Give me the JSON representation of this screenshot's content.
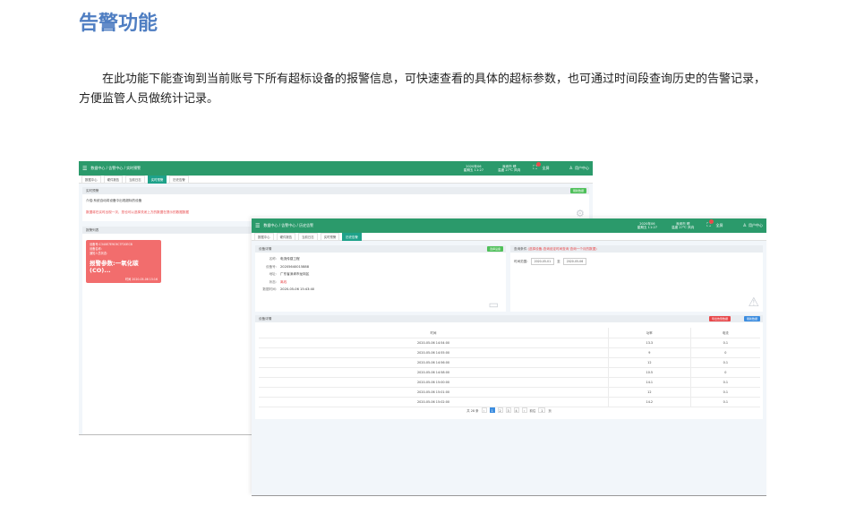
{
  "doc": {
    "title": "告警功能",
    "intro": "在此功能下能查询到当前账号下所有超标设备的报警信息，可快速查看的具体的超标参数，也可通过时间段查询历史的告警记录，方便监管人员做统计记录。"
  },
  "win1": {
    "breadcrumb": "数据中心 / 告警中心 / 实时预警",
    "stats": [
      {
        "line1": "2020年06",
        "line2": "星期五 11:27"
      },
      {
        "line1": "深圳市 晴",
        "line2": "温度 27℃ 风向"
      }
    ],
    "fullscreen": "全屏",
    "user": "用户中心",
    "tabs": [
      "数据中心",
      "硬件报告",
      "当前日志",
      "实时预警",
      "历史告警"
    ],
    "active_tab": "实时预警",
    "panel1": {
      "title": "实时预警",
      "button": "刷新数据",
      "line1": "介绍:系统自动将设备中出现超标的设备",
      "line2": "数据将在实时出现一次，您也可以选择关闭上方的数据在提示的数据数据"
    },
    "panel2": {
      "title": "报警列表",
      "card": {
        "line1": "设备号:C340E7E9C9C7F20ECB",
        "line2": "设备名称:",
        "line3": "通知人员状态:",
        "param": "报警参数:一氧化碳(CO)...",
        "time": "时间 2020-05-06 15:16"
      }
    }
  },
  "win2": {
    "breadcrumb": "数据中心 / 告警中心 / 历史告警",
    "stats": [
      {
        "line1": "2020年06",
        "line2": "星期五 11:27"
      },
      {
        "line1": "深圳市 晴",
        "line2": "温度 27℃ 风向"
      }
    ],
    "fullscreen": "全屏",
    "user": "用户中心",
    "tabs": [
      "数据中心",
      "硬件报告",
      "当前日志",
      "实时预警",
      "历史告警"
    ],
    "active_tab": "历史告警",
    "device_panel": {
      "title": "设备详情",
      "button": "选择设备",
      "fields": [
        {
          "k": "名称:",
          "v": "电流传感工程"
        },
        {
          "k": "设备号:",
          "v": "20205640015888"
        },
        {
          "k": "地址:",
          "v": "广东省深圳市龙岗区"
        },
        {
          "k": "状态:",
          "v": "离线"
        },
        {
          "k": "数据时间:",
          "v": "2020-05-06 15:43:40"
        }
      ]
    },
    "query_panel": {
      "title": "查询条件",
      "hint": "(选择设备-查询设定时间查询 查询一个月的数据)",
      "label": "时间范围:",
      "start": "2020-05-01",
      "sep": "至",
      "end": "2020-05-06"
    },
    "detail_panel": {
      "title": "设备详情",
      "btn_export": "导出告警数据",
      "btn_refresh": "刷新数据",
      "columns": [
        "时间",
        "功率",
        "电流"
      ],
      "rows": [
        [
          "2020-05-06 14:54:00",
          "13.3",
          "0.1"
        ],
        [
          "2020-05-06 14:55:00",
          "9",
          "0"
        ],
        [
          "2020-05-06 14:56:00",
          "12",
          "0.1"
        ],
        [
          "2020-05-06 14:58:00",
          "10.5",
          "0"
        ],
        [
          "2020-05-06 15:00:00",
          "14.1",
          "0.1"
        ],
        [
          "2020-05-06 15:01:00",
          "12",
          "0.1"
        ],
        [
          "2020-05-06 15:02:00",
          "14.2",
          "0.1"
        ]
      ],
      "pager": {
        "total": "共 28 条",
        "pages": [
          "1",
          "2",
          "3",
          "4"
        ],
        "current": "1",
        "goto_label": "前往",
        "goto_value": "1",
        "goto_suffix": "页"
      }
    }
  }
}
